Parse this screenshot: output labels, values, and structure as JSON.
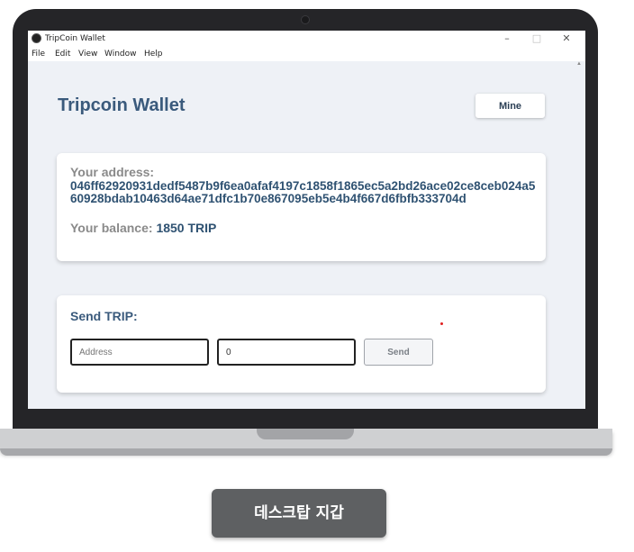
{
  "window": {
    "title": "TripCoin Wallet",
    "controls": {
      "minimize": "–",
      "maximize": "□",
      "close": "✕"
    }
  },
  "menu": [
    "File",
    "Edit",
    "View",
    "Window",
    "Help"
  ],
  "app": {
    "title": "Tripcoin Wallet",
    "mine_label": "Mine",
    "address_label": "Your address:",
    "address_value": "046ff62920931dedf5487b9f6ea0afaf4197c1858f1865ec5a2bd26ace02ce8ceb024a560928bdab10463d64ae71dfc1b70e867095eb5e4b4f667d6fbfb333704d",
    "balance_label": "Your balance:",
    "balance_value": "1850 TRIP",
    "send_title": "Send TRIP:",
    "address_placeholder": "Address",
    "amount_value": "0",
    "send_label": "Send"
  },
  "caption": "데스크탑 지갑",
  "colors": {
    "accent": "#3a5a7c",
    "background": "#eef1f6",
    "laptop": "#252528"
  }
}
